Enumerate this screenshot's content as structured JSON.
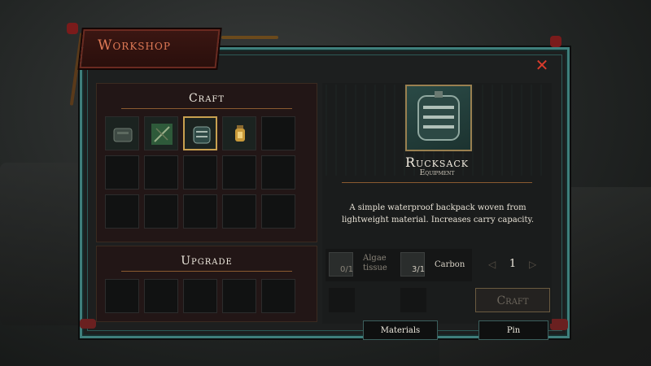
{
  "window": {
    "title": "Workshop",
    "close_label": "✕"
  },
  "craft_section": {
    "title": "Craft",
    "slots": [
      {
        "item": "backpack-small-icon",
        "filled": true,
        "selected": false
      },
      {
        "item": "crossbow-icon",
        "filled": true,
        "selected": false
      },
      {
        "item": "rucksack-icon",
        "filled": true,
        "selected": true
      },
      {
        "item": "lantern-icon",
        "filled": true,
        "selected": false
      },
      {
        "item": "",
        "filled": false,
        "selected": false
      }
    ]
  },
  "upgrade_section": {
    "title": "Upgrade"
  },
  "item_detail": {
    "name": "Rucksack",
    "type": "Equipment",
    "description": "A simple waterproof backpack woven from lightweight material. Increases carry capacity."
  },
  "materials": [
    {
      "name": "Algae tissue",
      "count": "0/1",
      "available": false
    },
    {
      "name": "Carbon",
      "count": "3/1",
      "available": true
    }
  ],
  "quantity": {
    "value": "1",
    "prev_icon": "◁",
    "next_icon": "▷"
  },
  "buttons": {
    "craft": "Craft",
    "materials": "Materials",
    "pin": "Pin"
  },
  "colors": {
    "frame": "#3f7f7c",
    "title_accent": "#e07a56",
    "close": "#d83b2c",
    "selected_slot": "#c8a050"
  }
}
